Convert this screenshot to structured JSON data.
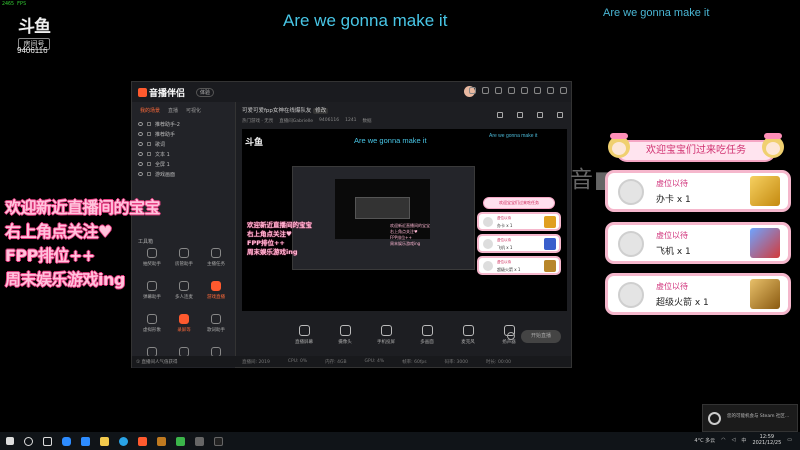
{
  "overlay": {
    "fps": "2465 FPS",
    "room_label": "房间号",
    "room_id": "9406116",
    "lyric_main": "Are we gonna make it",
    "lyric_right": "Are we gonna make it",
    "promo_lines": [
      "欢迎新近直播间的宝宝",
      "右上角点关注♥",
      "FPP排位++",
      "周末娱乐游戏ing"
    ],
    "watermark": "音■■",
    "task_banner": "欢迎宝宝们过来吃任务",
    "cards": [
      {
        "status": "虚位以待",
        "gift": "办卡 x 1",
        "icon": "gold-card-icon"
      },
      {
        "status": "虚位以待",
        "gift": "飞机 x 1",
        "icon": "airplane-icon"
      },
      {
        "status": "虚位以待",
        "gift": "超级火箭 x 1",
        "icon": "rocket-icon"
      }
    ]
  },
  "app": {
    "name": "音播伴侣",
    "version": "体验",
    "scene_tabs": [
      "我的场景",
      "直播",
      "可视化"
    ],
    "layers": [
      "推荐助手-2",
      "推荐助手",
      "歌词",
      "文本 1",
      "全屏 1",
      "游戏画面"
    ],
    "tools_label": "工具箱",
    "tools": [
      "抽奖助手",
      "房管助手",
      "主播任务",
      "弹幕助手",
      "多人连麦",
      "游戏直播",
      "虚拟形象",
      "录屏等",
      "歌词助手",
      "",
      "",
      ""
    ],
    "stream_title": "可爱可爱fpp女神在线爆队友",
    "stream_title_tag": "修改",
    "stream_info": [
      "热门游戏 · 无畏",
      "直播间Gabrielle",
      "9406116",
      "1241",
      "数据"
    ],
    "controls": [
      "直播屏幕",
      "摄像头",
      "手机投屏",
      "多画面",
      "麦克风",
      "扬声器"
    ],
    "live_button": "开始直播",
    "status_items": [
      "直播间: 2019",
      "CPU: 0%",
      "内存: 4GB",
      "GPU: 4%",
      "帧率: 60fps",
      "码率: 3000",
      "时长: 00:00"
    ],
    "status_first": "① 直播间人气值获得",
    "preview": {
      "lyric_main": "Are we gonna make it",
      "lyric_right": "Are we gonna make it",
      "promo": [
        "欢迎新近直播间的宝宝",
        "右上角点关注♥",
        "FPP排位++",
        "周末娱乐游戏ing"
      ],
      "promo_small": [
        "欢迎新近直播间的宝宝",
        "右上角点关注♥",
        "FPP排位++",
        "周末娱乐游戏ing"
      ],
      "banner": "欢迎宝宝们过来吃任务",
      "cards": [
        {
          "status": "虚位以待",
          "gift": "办卡 x 1"
        },
        {
          "status": "虚位以待",
          "gift": "飞机 x 1"
        },
        {
          "status": "虚位以待",
          "gift": "超级火箭 x 1"
        }
      ]
    }
  },
  "steam": {
    "message": "您的可能机会与 Steam 社区..."
  },
  "taskbar": {
    "weather": "4°C 多云",
    "ime": "中",
    "time": "12:59",
    "date": "2021/12/25"
  },
  "colors": {
    "accent": "#ff5a2e",
    "pink": "#f5b7cc",
    "lyric": "#48c6e6"
  }
}
